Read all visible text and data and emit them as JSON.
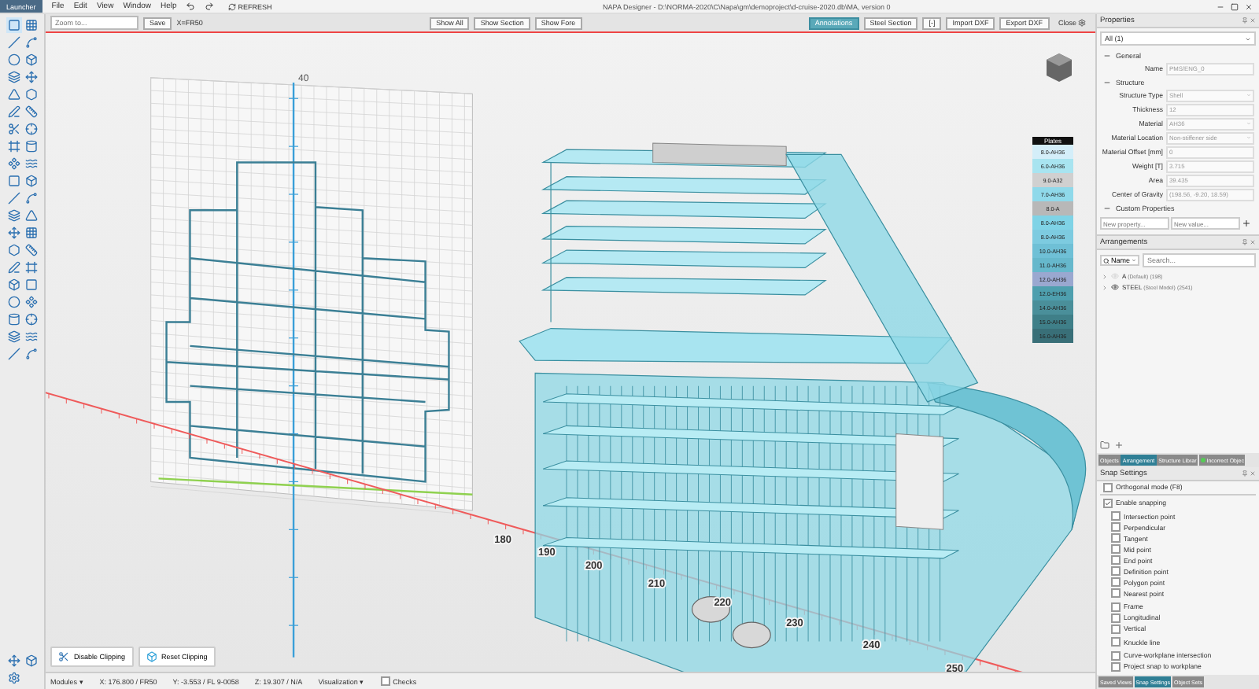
{
  "window": {
    "title": "NAPA Designer - D:\\NORMA-2020\\C\\Napa\\gm\\demoproject\\d-cruise-2020.db\\MA, version 0",
    "app_button": "Launcher",
    "menus": [
      "File",
      "Edit",
      "View",
      "Window",
      "Help"
    ],
    "refresh": "REFRESH"
  },
  "toolbar": {
    "zoom_placeholder": "Zoom to...",
    "save": "Save",
    "coordinate": "X=FR50",
    "view_buttons": [
      "Show All",
      "Show Section",
      "Show Fore"
    ],
    "right_buttons": [
      {
        "label": "Annotations",
        "selected": true
      },
      {
        "label": "Steel Section",
        "selected": false
      },
      {
        "label": "[-]",
        "selected": false
      },
      {
        "label": "Import DXF",
        "selected": false
      },
      {
        "label": "Export DXF",
        "selected": false
      }
    ],
    "close": "Close"
  },
  "viewport": {
    "vertical_ticks": [
      "40"
    ],
    "axis_ticks": [
      "180",
      "190",
      "200",
      "210",
      "220",
      "230",
      "240",
      "250"
    ],
    "legend": {
      "title": "Plates",
      "items": [
        {
          "label": "8.0-AH36",
          "color": "#d4eef9"
        },
        {
          "label": "6.0-AH36",
          "color": "#a8e4f0"
        },
        {
          "label": "9.0-A32",
          "color": "#d0d0d0"
        },
        {
          "label": "7.0-AH36",
          "color": "#8fd9ea"
        },
        {
          "label": "8.0-A",
          "color": "#b8b8b8"
        },
        {
          "label": "8.0-AH36",
          "color": "#7fd3e6"
        },
        {
          "label": "8.0-AH36",
          "color": "#7dcbe0"
        },
        {
          "label": "10.0-AH36",
          "color": "#6fc0d6"
        },
        {
          "label": "11.0-AH36",
          "color": "#66b8cc"
        },
        {
          "label": "12.0-AH36",
          "color": "#9aa8d0"
        },
        {
          "label": "12.0-EH36",
          "color": "#4e9fae"
        },
        {
          "label": "14.0-AH36",
          "color": "#4a8f9a"
        },
        {
          "label": "15.0-AH36",
          "color": "#3f7f88"
        },
        {
          "label": "16.0-AH36",
          "color": "#396f78"
        }
      ]
    },
    "clip_buttons": [
      "Disable Clipping",
      "Reset Clipping"
    ]
  },
  "properties": {
    "title": "Properties",
    "selection": "All (1)",
    "sections": [
      {
        "title": "General",
        "expanded": true,
        "fields": [
          {
            "label": "Name",
            "value": "PMS/ENG_0",
            "kind": "text"
          }
        ]
      },
      {
        "title": "Structure",
        "expanded": true,
        "fields": [
          {
            "label": "Structure Type",
            "value": "Shell",
            "kind": "select"
          },
          {
            "label": "Thickness",
            "value": "12",
            "kind": "text"
          },
          {
            "label": "Material",
            "value": "AH36",
            "kind": "select"
          },
          {
            "label": "Material Location",
            "value": "Non-stiffener side",
            "kind": "select"
          },
          {
            "label": "Material Offset [mm]",
            "value": "0",
            "kind": "text"
          },
          {
            "label": "Weight [T]",
            "value": "3.715",
            "kind": "text"
          },
          {
            "label": "Area",
            "value": "39.435",
            "kind": "text"
          },
          {
            "label": "Center of Gravity",
            "value": "(198.56, -9.20, 18.59)",
            "kind": "text"
          }
        ]
      },
      {
        "title": "Custom Properties",
        "expanded": true
      }
    ],
    "new_property_placeholder": "New property...",
    "new_value_placeholder": "New value..."
  },
  "arrangements": {
    "title": "Arrangements",
    "filter": "Name",
    "search_placeholder": "Search...",
    "items": [
      {
        "name": "A",
        "detail": "(Default)",
        "count": "(198)",
        "visible": false
      },
      {
        "name": "STEEL",
        "detail": "(Steel Model)",
        "count": "(2541)",
        "visible": true
      }
    ]
  },
  "panel_tabs": [
    {
      "label": "Objects",
      "selected": false
    },
    {
      "label": "Arrangement",
      "selected": true
    },
    {
      "label": "Structure Librar",
      "selected": false
    },
    {
      "label": "Incorrect Objec",
      "selected": false
    }
  ],
  "snap_settings": {
    "title": "Snap Settings",
    "options": [
      {
        "label": "Orthogonal mode (F8)",
        "checked": false
      },
      {
        "label": "Enable snapping",
        "checked": true,
        "groups": [
          {
            "items": [
              {
                "label": "Intersection point",
                "checked": false
              },
              {
                "label": "Perpendicular",
                "checked": false
              },
              {
                "label": "Tangent",
                "checked": false
              },
              {
                "label": "Mid point",
                "checked": false
              },
              {
                "label": "End point",
                "checked": false
              },
              {
                "label": "Definition point",
                "checked": false
              },
              {
                "label": "Polygon point",
                "checked": false
              },
              {
                "label": "Nearest point",
                "checked": false
              }
            ]
          },
          {
            "items": [
              {
                "label": "Frame",
                "checked": false
              },
              {
                "label": "Longitudinal",
                "checked": false
              },
              {
                "label": "Vertical",
                "checked": false
              }
            ]
          },
          {
            "items": [
              {
                "label": "Knuckle line",
                "checked": false
              }
            ]
          },
          {
            "items": [
              {
                "label": "Curve-workplane intersection",
                "checked": false
              },
              {
                "label": "Project snap to workplane",
                "checked": false
              }
            ]
          }
        ]
      }
    ]
  },
  "bottom_tabs": [
    {
      "label": "Saved Views",
      "selected": false
    },
    {
      "label": "Snap Settings",
      "selected": true
    },
    {
      "label": "Object Sets",
      "selected": false
    }
  ],
  "status_bar": {
    "modules": "Modules ▾",
    "coordinates": [
      "X: 176.800 / FR50",
      "Y: -3.553 / FL 9-0058",
      "Z: 19.307 / N/A"
    ],
    "visualization": "Visualization ▾",
    "checks": {
      "label": "Checks",
      "checked": false
    }
  }
}
